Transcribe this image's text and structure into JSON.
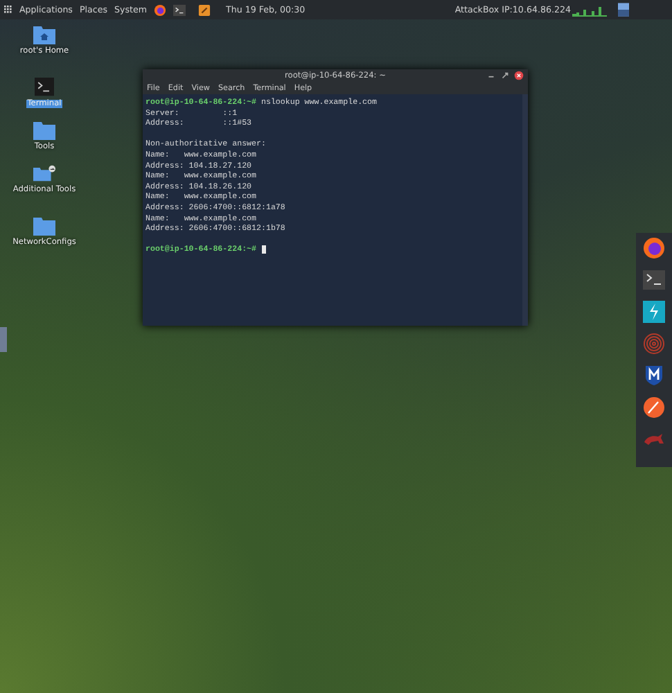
{
  "panel": {
    "menus": [
      "Applications",
      "Places",
      "System"
    ],
    "clock": "Thu 19 Feb, 00:30",
    "ip_label": "AttackBox IP:10.64.86.224"
  },
  "desktop_icons": [
    {
      "label": "root's Home",
      "kind": "home",
      "selected": false
    },
    {
      "label": "Terminal",
      "kind": "terminal",
      "selected": true
    },
    {
      "label": "Tools",
      "kind": "folder",
      "selected": false
    },
    {
      "label": "Additional Tools",
      "kind": "link",
      "selected": false
    },
    {
      "label": "NetworkConfigs",
      "kind": "folder",
      "selected": false
    }
  ],
  "terminal": {
    "title": "root@ip-10-64-86-224: ~",
    "menu": [
      "File",
      "Edit",
      "View",
      "Search",
      "Terminal",
      "Help"
    ],
    "lines": [
      {
        "kind": "prompt",
        "prompt": "root@ip-10-64-86-224:~#",
        "command": "nslookup www.example.com"
      },
      {
        "kind": "output",
        "text": "Server:         ::1"
      },
      {
        "kind": "output",
        "text": "Address:        ::1#53"
      },
      {
        "kind": "blank"
      },
      {
        "kind": "output",
        "text": "Non-authoritative answer:"
      },
      {
        "kind": "output",
        "text": "Name:   www.example.com"
      },
      {
        "kind": "output",
        "text": "Address: 104.18.27.120"
      },
      {
        "kind": "output",
        "text": "Name:   www.example.com"
      },
      {
        "kind": "output",
        "text": "Address: 104.18.26.120"
      },
      {
        "kind": "output",
        "text": "Name:   www.example.com"
      },
      {
        "kind": "output",
        "text": "Address: 2606:4700::6812:1a78"
      },
      {
        "kind": "output",
        "text": "Name:   www.example.com"
      },
      {
        "kind": "output",
        "text": "Address: 2606:4700::6812:1b78"
      },
      {
        "kind": "blank"
      },
      {
        "kind": "cursor",
        "prompt": "root@ip-10-64-86-224:~#"
      }
    ]
  }
}
